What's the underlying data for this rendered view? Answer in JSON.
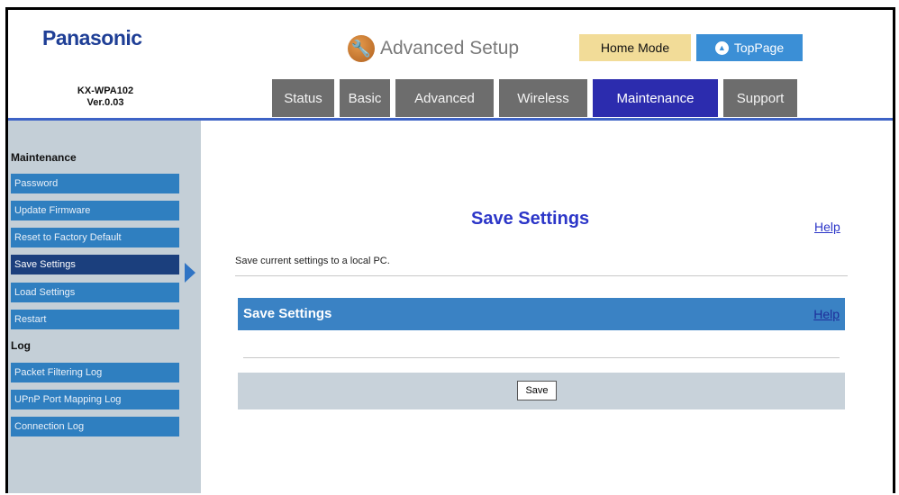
{
  "header": {
    "brand": "Panasonic",
    "model": "KX-WPA102",
    "version": "Ver.0.03",
    "title": "Advanced Setup",
    "home_mode": "Home Mode",
    "toppage": "TopPage"
  },
  "tabs": [
    {
      "label": "Status"
    },
    {
      "label": "Basic"
    },
    {
      "label": "Advanced"
    },
    {
      "label": "Wireless"
    },
    {
      "label": "Maintenance",
      "active": true
    },
    {
      "label": "Support"
    }
  ],
  "sidebar": {
    "sections": [
      {
        "heading": "Maintenance",
        "items": [
          "Password",
          "Update Firmware",
          "Reset to Factory Default",
          "Save Settings",
          "Load Settings",
          "Restart"
        ]
      },
      {
        "heading": "Log",
        "items": [
          "Packet Filtering Log",
          "UPnP Port Mapping Log",
          "Connection Log"
        ]
      }
    ],
    "active_item": "Save Settings"
  },
  "main": {
    "title": "Save Settings",
    "help": "Help",
    "description": "Save current settings to a local PC.",
    "section_title": "Save Settings",
    "section_help": "Help",
    "save_button": "Save"
  },
  "colors": {
    "brand": "#1f3f96",
    "active_tab": "#2c2cae",
    "tab": "#6d6d6d",
    "section_bar": "#3a82c4",
    "sidebar_item": "#2f7fc0",
    "sidebar_active": "#1b3f7d"
  },
  "icons": {
    "title": "wrench-icon",
    "toppage": "up-arrow-circle-icon",
    "pointer": "triangle-right-icon"
  }
}
